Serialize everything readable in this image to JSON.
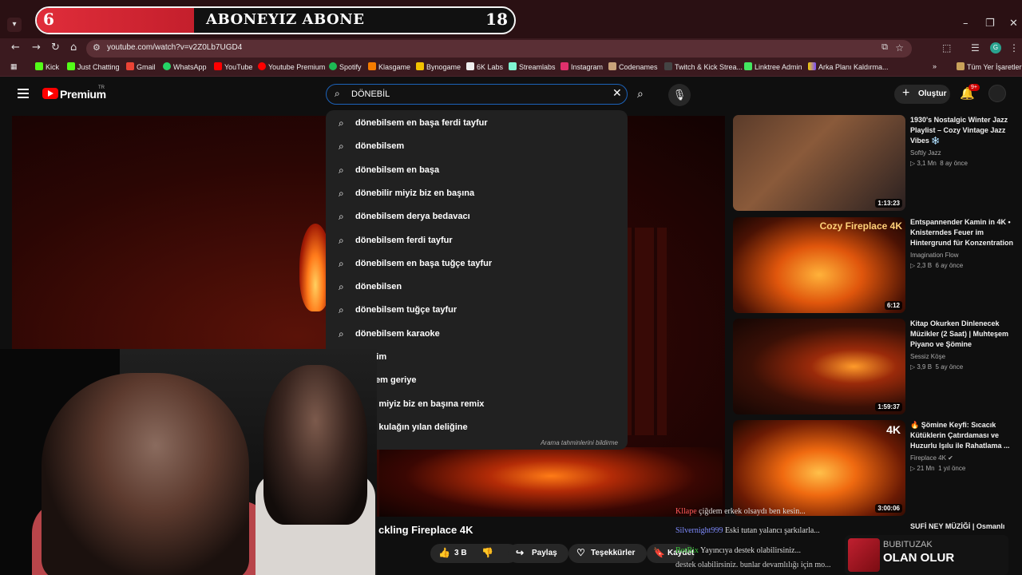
{
  "overlay": {
    "left_number": "6",
    "title": "ABONEYIZ ABONE",
    "right_number": "18",
    "progress_fraction": 0.33
  },
  "browser": {
    "url": "youtube.com/watch?v=v2Z0Lb7UGD4",
    "bookmarks": [
      "Kick",
      "Just Chatting",
      "Gmail",
      "WhatsApp",
      "YouTube",
      "Youtube Premium",
      "Spotify",
      "Klasgame",
      "Bynogame",
      "6K Labs",
      "Streamlabs",
      "Instagram",
      "Codenames",
      "Twitch & Kick Strea...",
      "Linktree Admin",
      "Arka Planı Kaldırma..."
    ],
    "all_bookmarks": "Tüm Yer İşaretleri",
    "profile_initial": "G"
  },
  "youtube": {
    "brand": "Premium",
    "country": "TR",
    "search_query": "DÖNEBİL",
    "create_label": "Oluştur",
    "notif_count": "9+"
  },
  "suggestions": [
    "dönebilsem en başa ferdi tayfur",
    "dönebilsem",
    "dönebilsem en başa",
    "dönebilir miyiz biz en başına",
    "dönebilsem derya bedavacı",
    "dönebilsem ferdi tayfur",
    "dönebilsem en başa tuğçe tayfur",
    "dönebilsen",
    "dönebilsem tuğçe tayfur",
    "dönebilsem karaoke",
    "ebilirim",
    "ebilsem geriye",
    "ebilir miyiz biz en başına remix",
    "ebilir kulağın yılan deliğine"
  ],
  "suggest_footer": "Arama tahminlerini bildirme",
  "video": {
    "title_partial": "ckling Fireplace 4K",
    "likes": "3 B",
    "share": "Paylaş",
    "thanks": "Teşekkürler",
    "save": "Kaydet"
  },
  "recommendations": [
    {
      "title": "1930's Nostalgic Winter Jazz Playlist – Cozy Vintage Jazz Vibes ❄️",
      "channel": "Softly Jazz",
      "views": "▷ 3,1 Mn",
      "age": "8 ay önce",
      "duration": "1:13:23"
    },
    {
      "title": "Entspannender Kamin in 4K • Knisterndes Feuer im Hintergrund für Konzentration",
      "channel": "Imagination Flow",
      "views": "▷ 2,3 B",
      "age": "6 ay önce",
      "duration": "6:12",
      "thumb_text": "Cozy Fireplace 4K"
    },
    {
      "title": "Kitap Okurken Dinlenecek Müzikler (2 Saat) | Muhteşem Piyano ve Şömine",
      "channel": "Sessiz Köşe",
      "views": "▷ 3,9 B",
      "age": "5 ay önce",
      "duration": "1:59:37"
    },
    {
      "title": "🔥 Şömine Keyfi: Sıcacık Kütüklerin Çatırdaması ve Huzurlu Işılu ile Rahatlama ...",
      "channel": "Fireplace 4K ✔",
      "views": "▷ 21 Mn",
      "age": "1 yıl önce",
      "duration": "3:00:06",
      "thumb_text": "4K"
    }
  ],
  "next_rec_title": "SUFİ NEY MÜZİĞİ | Osmanlı",
  "chat": [
    {
      "user": "Kllape",
      "text": "çiğdem erkek olsaydı ben kesin...",
      "color": "#ff5a5a"
    },
    {
      "user": "Silvernight999",
      "text": "Eski tutan yalancı şarkılarla...",
      "color": "#7f8cff"
    },
    {
      "user": "BotRix",
      "text": "Yayıncıya destek olabilirsiniz...",
      "color": "#3ec93e"
    },
    {
      "user": "",
      "text": "destek olabilirsiniz. bunlar devamlılığı için mo...",
      "color": "#bbb"
    }
  ],
  "sub_alert": {
    "name": "BUBITUZAK",
    "message": "OLAN OLUR"
  }
}
